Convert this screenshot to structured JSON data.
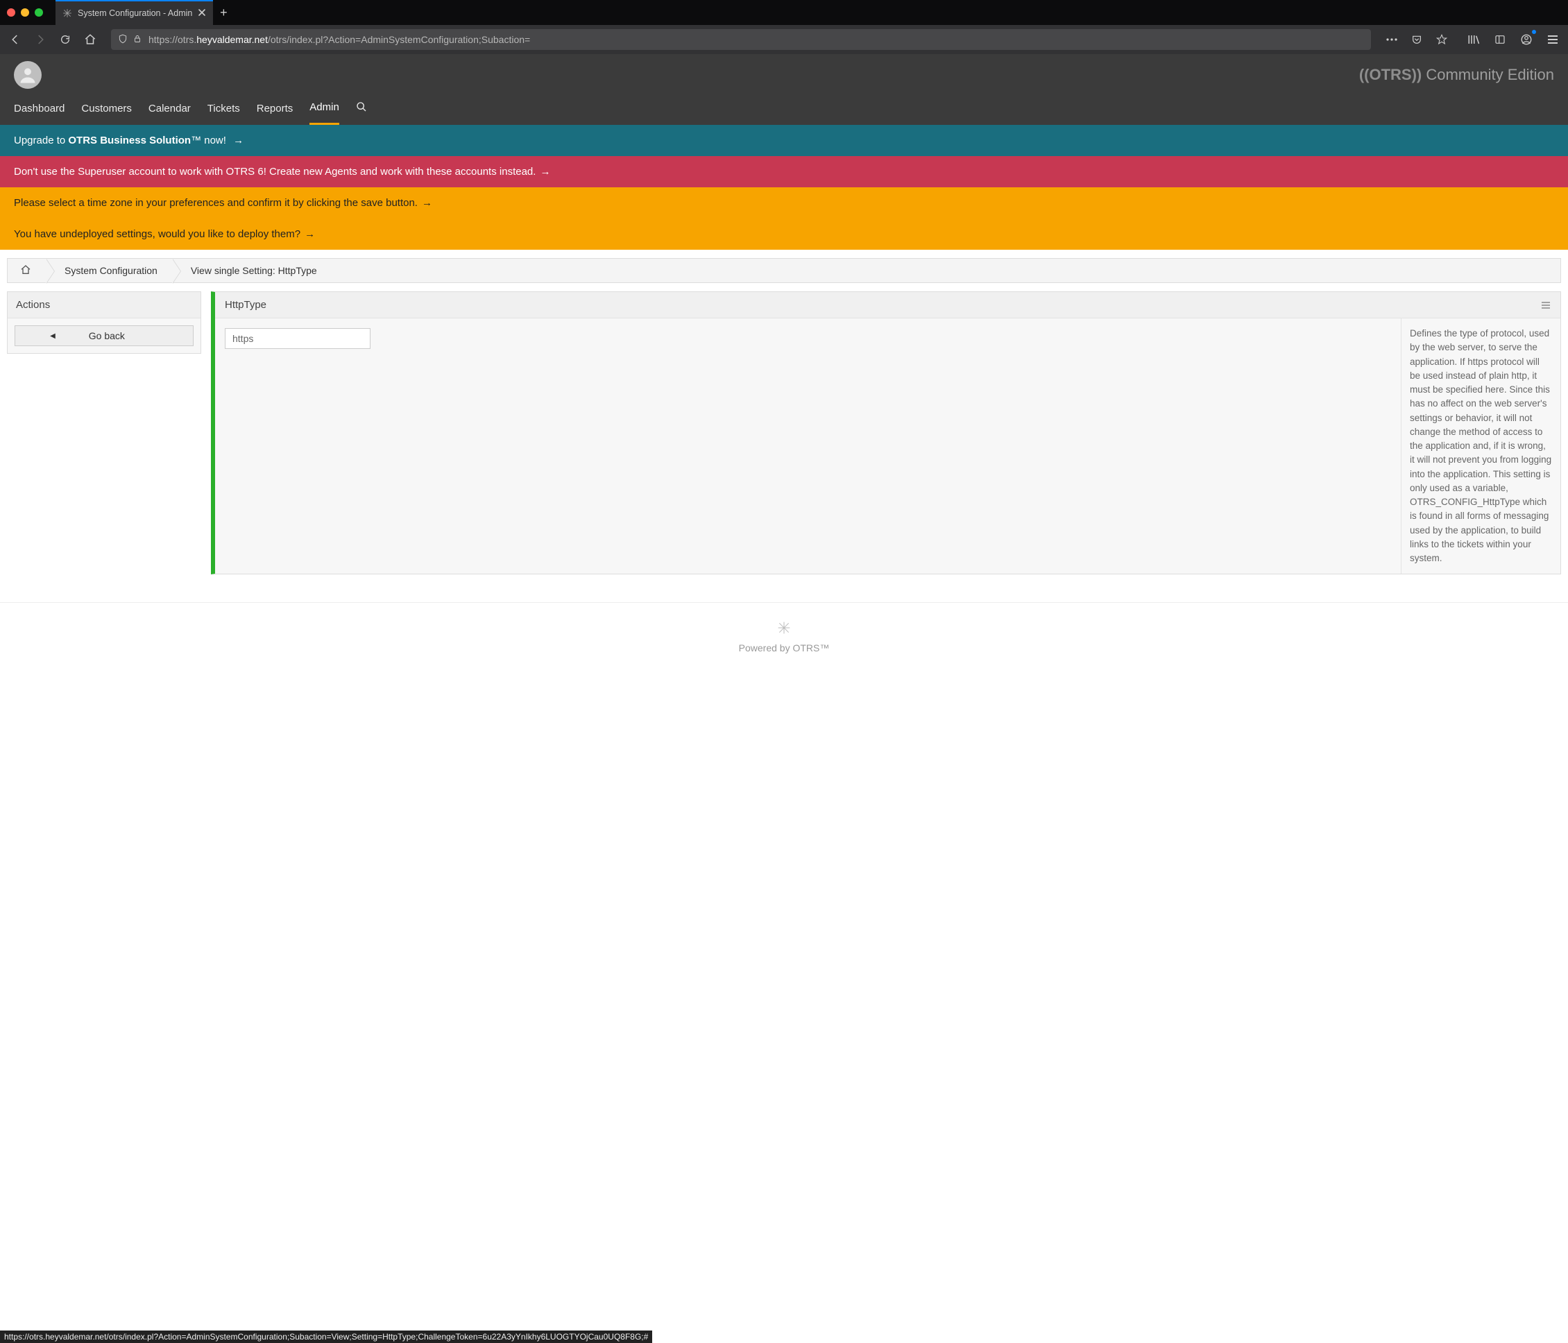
{
  "browser": {
    "tab_title": "System Configuration - Admin",
    "url_prefix": "https://otrs.",
    "url_highlight": "heyvaldemar.net",
    "url_suffix": "/otrs/index.pl?Action=AdminSystemConfiguration;Subaction="
  },
  "brand": {
    "otrs": "((OTRS))",
    "edition": "Community Edition"
  },
  "nav": {
    "items": [
      "Dashboard",
      "Customers",
      "Calendar",
      "Tickets",
      "Reports",
      "Admin"
    ],
    "active": "Admin"
  },
  "banners": {
    "upgrade_pre": "Upgrade to ",
    "upgrade_bold": "OTRS Business Solution",
    "upgrade_tm": "™",
    "upgrade_post": " now! ",
    "superuser": "Don't use the Superuser account to work with OTRS 6! Create new Agents and work with these accounts instead. ",
    "timezone": "Please select a time zone in your preferences and confirm it by clicking the save button. ",
    "undeployed": "You have undeployed settings, would you like to deploy them? ",
    "arrow": "→"
  },
  "breadcrumb": {
    "sysconfig": "System Configuration",
    "view": "View single Setting: HttpType"
  },
  "actions": {
    "title": "Actions",
    "go_back": "Go back"
  },
  "setting": {
    "title": "HttpType",
    "value": "https",
    "description": "Defines the type of protocol, used by the web server, to serve the application. If https protocol will be used instead of plain http, it must be specified here. Since this has no affect on the web server's settings or behavior, it will not change the method of access to the application and, if it is wrong, it will not prevent you from logging into the application. This setting is only used as a variable, OTRS_CONFIG_HttpType which is found in all forms of messaging used by the application, to build links to the tickets within your system."
  },
  "footer": {
    "text": "Powered by OTRS™"
  },
  "statusbar": {
    "text": "https://otrs.heyvaldemar.net/otrs/index.pl?Action=AdminSystemConfiguration;Subaction=View;Setting=HttpType;ChallengeToken=6u22A3yYnIkhy6LUOGTYOjCau0UQ8F8G;#"
  }
}
